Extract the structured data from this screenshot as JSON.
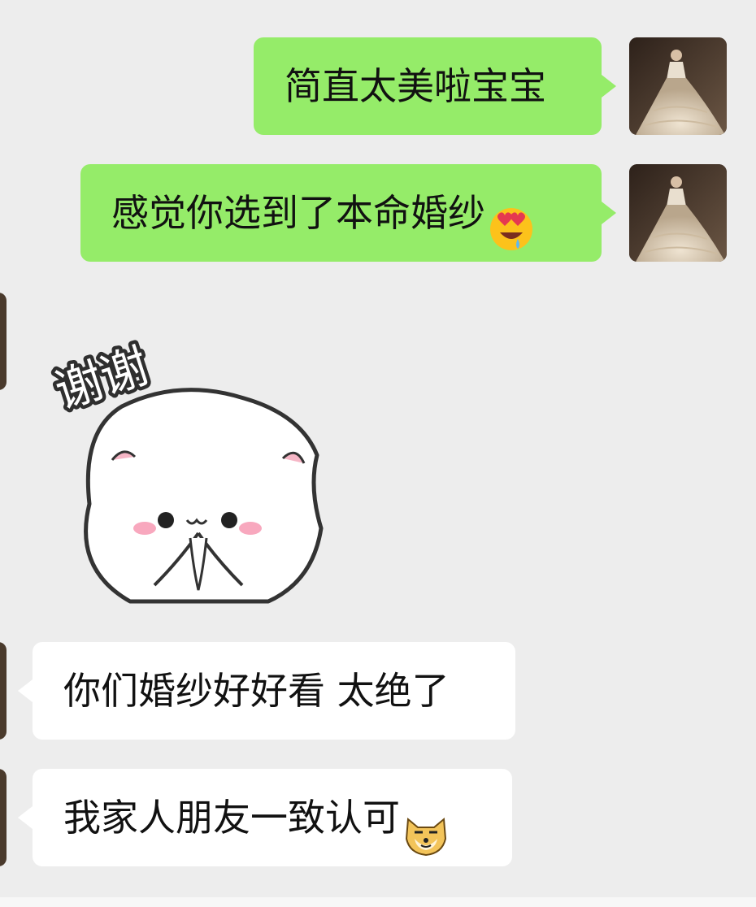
{
  "chat": {
    "messages": [
      {
        "direction": "sent",
        "text": "简直太美啦宝宝",
        "emoji": ""
      },
      {
        "direction": "sent",
        "text": "感觉你选到了本命婚纱",
        "emoji": "heart-eyes-drool-emoji"
      },
      {
        "direction": "received",
        "type": "sticker",
        "sticker_text": "谢谢",
        "sticker": "hamster-thanks-sticker"
      },
      {
        "direction": "received",
        "text": "你们婚纱好好看 太绝了",
        "emoji": ""
      },
      {
        "direction": "received",
        "text": "我家人朋友一致认可",
        "emoji": "doge-emoji"
      }
    ]
  },
  "colors": {
    "background": "#ededed",
    "sent_bubble": "#95ec69",
    "received_bubble": "#ffffff"
  }
}
